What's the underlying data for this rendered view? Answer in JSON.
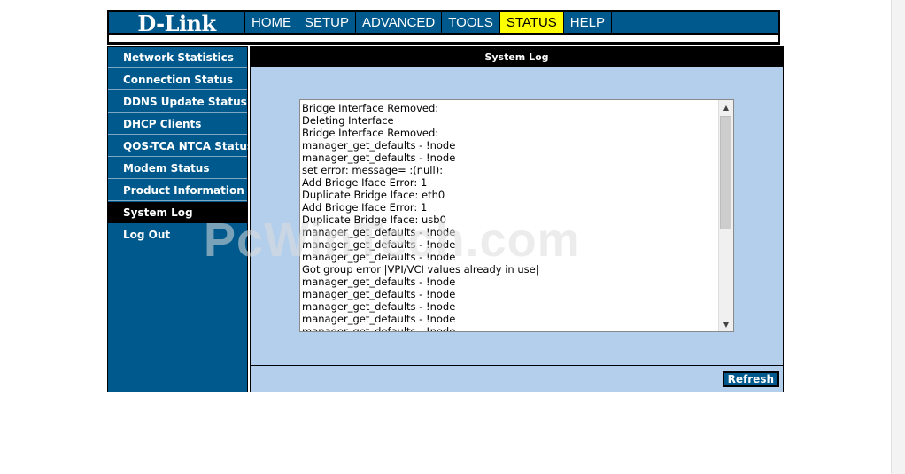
{
  "brand": {
    "logo_text": "D-Link"
  },
  "nav": {
    "items": [
      {
        "label": "HOME"
      },
      {
        "label": "SETUP"
      },
      {
        "label": "ADVANCED"
      },
      {
        "label": "TOOLS"
      },
      {
        "label": "STATUS",
        "active": true
      },
      {
        "label": "HELP"
      }
    ]
  },
  "sidebar": {
    "items": [
      {
        "label": "Network Statistics"
      },
      {
        "label": "Connection Status"
      },
      {
        "label": "DDNS Update Status"
      },
      {
        "label": "DHCP Clients"
      },
      {
        "label": "QOS-TCA NTCA Status"
      },
      {
        "label": "Modem Status"
      },
      {
        "label": "Product Information"
      },
      {
        "label": "System Log",
        "active": true
      },
      {
        "label": "Log Out"
      }
    ]
  },
  "main": {
    "title": "System Log",
    "log_lines": [
      "Bridge Interface Removed:",
      "Deleting Interface",
      "Bridge Interface Removed:",
      "manager_get_defaults - !node",
      "manager_get_defaults - !node",
      "set error: message= :(null):",
      "Add Bridge Iface Error: 1",
      "Duplicate Bridge Iface: eth0",
      "Add Bridge Iface Error: 1",
      "Duplicate Bridge Iface: usb0",
      "manager_get_defaults - !node",
      "manager_get_defaults - !node",
      "manager_get_defaults - !node",
      "Got group error |VPI/VCI values already in use|",
      "manager_get_defaults - !node",
      "manager_get_defaults - !node",
      "manager_get_defaults - !node",
      "manager_get_defaults - !node",
      "manager_get_defaults - !node"
    ],
    "refresh_label": "Refresh"
  },
  "watermark": "PcWinTech.com",
  "colors": {
    "brand_blue": "#00598c",
    "content_bg": "#b4cfeb",
    "active_tab": "#ffff00"
  }
}
